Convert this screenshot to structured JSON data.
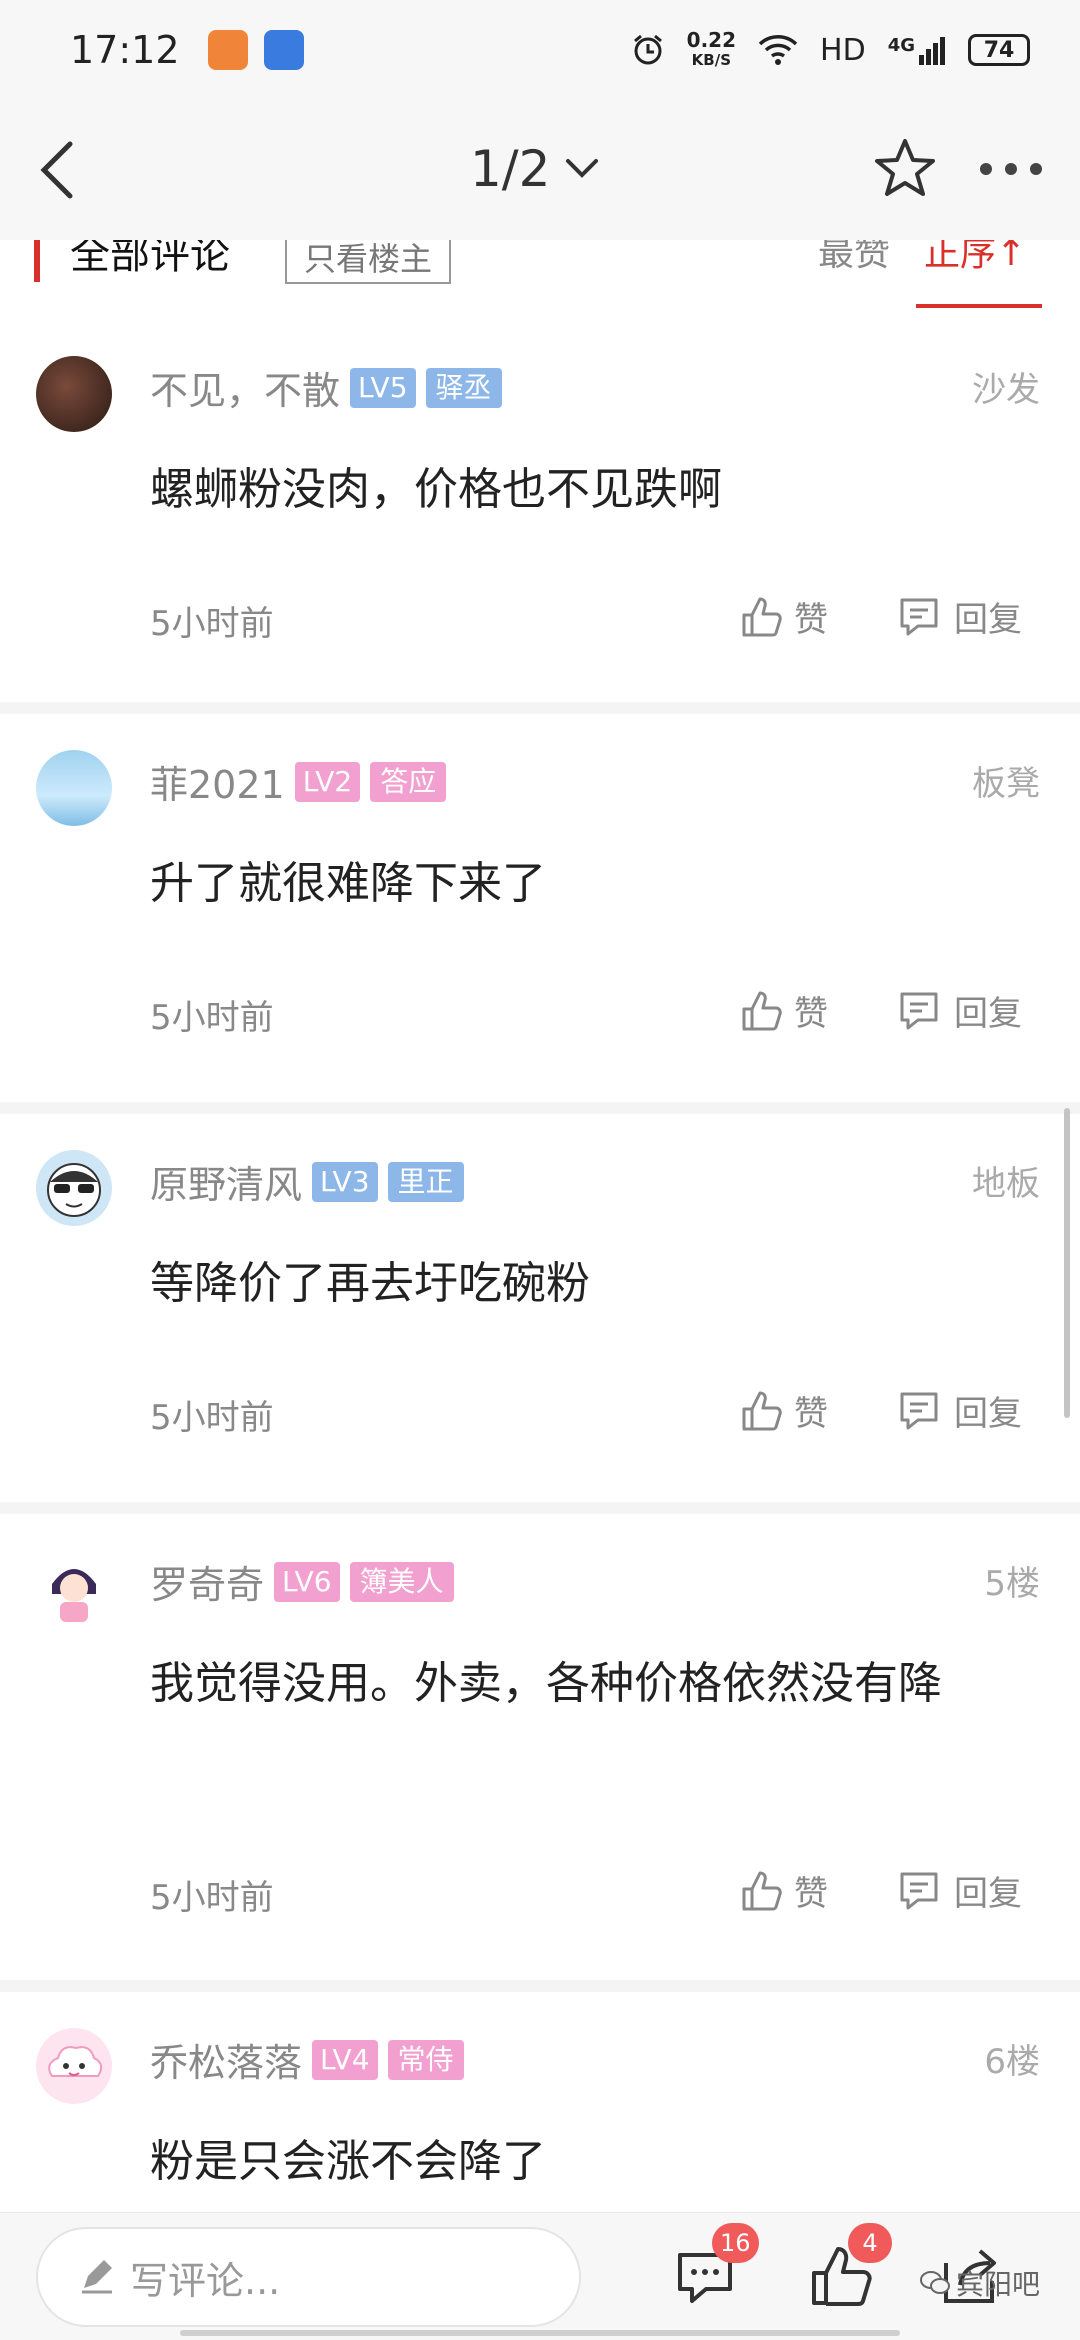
{
  "status_bar": {
    "time": "17:12",
    "network_speed": "0.22",
    "network_unit": "KB/S",
    "hd": "HD",
    "signal": "4G",
    "battery": "74"
  },
  "nav": {
    "pager": "1/2"
  },
  "tabs": {
    "title": "全部评论",
    "only_owner": "只看楼主",
    "sort_hot": "最赞",
    "sort_asc": "正序↑"
  },
  "comments": [
    {
      "user": "不见，不散",
      "level": "LV5",
      "level_color": "#8db7e8",
      "title": "驿丞",
      "title_color": "#8db7e8",
      "floor": "沙发",
      "text": "螺蛳粉没肉，价格也不见跌啊",
      "time": "5小时前",
      "like": "赞",
      "reply": "回复"
    },
    {
      "user": "菲2021",
      "level": "LV2",
      "level_color": "#f2a0cf",
      "title": "答应",
      "title_color": "#f2a0cf",
      "floor": "板凳",
      "text": "升了就很难降下来了",
      "time": "5小时前",
      "like": "赞",
      "reply": "回复"
    },
    {
      "user": "原野清风",
      "level": "LV3",
      "level_color": "#8db7e8",
      "title": "里正",
      "title_color": "#8db7e8",
      "floor": "地板",
      "text": "等降价了再去圩吃碗粉",
      "time": "5小时前",
      "like": "赞",
      "reply": "回复"
    },
    {
      "user": "罗奇奇",
      "level": "LV6",
      "level_color": "#f2a0cf",
      "title": "簿美人",
      "title_color": "#f2a0cf",
      "floor": "5楼",
      "text": "我觉得没用。外卖，各种价格依然没有降",
      "time": "5小时前",
      "like": "赞",
      "reply": "回复"
    },
    {
      "user": "乔松落落",
      "level": "LV4",
      "level_color": "#f2a0cf",
      "title": "常侍",
      "title_color": "#f2a0cf",
      "floor": "6楼",
      "text": "粉是只会涨不会降了",
      "time": "",
      "like": "",
      "reply": ""
    }
  ],
  "bottom_bar": {
    "write_placeholder": "写评论...",
    "comment_count": "16",
    "like_count": "4",
    "watermark": "宾阳吧"
  },
  "colors": {
    "accent": "#d9302b",
    "badge": "#f05a5a"
  }
}
